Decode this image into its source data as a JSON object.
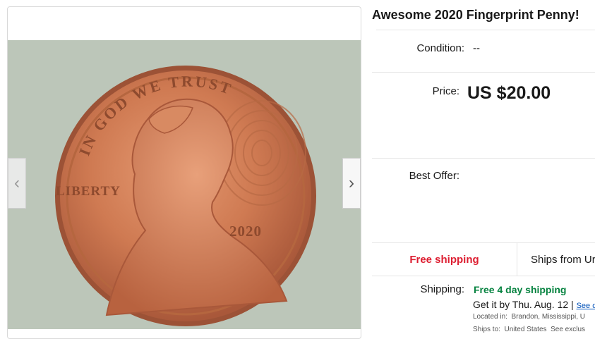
{
  "listing": {
    "title": "Awesome 2020 Fingerprint Penny!",
    "condition_label": "Condition:",
    "condition_value": "--",
    "price_label": "Price:",
    "price_value": "US $20.00",
    "best_offer_label": "Best Offer:"
  },
  "gallery": {
    "prev_arrow": "‹",
    "next_arrow": "›",
    "coin": {
      "motto": "IN GOD WE TRUST",
      "liberty": "LIBERTY",
      "year": "2020"
    }
  },
  "shipping": {
    "tab_free": "Free shipping",
    "tab_from": "Ships from Ur",
    "label": "Shipping:",
    "value": "Free 4 day shipping",
    "delivery_text": "Get it by Thu. Aug. 12 |",
    "delivery_link": "See d",
    "located_label": "Located in:",
    "located_value": "Brandon, Mississippi, U",
    "ships_to_label": "Ships to:",
    "ships_to_value": "United States",
    "ships_to_link": "See exclus"
  },
  "colors": {
    "free_shipping": "#dd1e31",
    "fast_shipping": "#05823f",
    "link": "#0654ba",
    "coin_copper": "#c9744c"
  }
}
